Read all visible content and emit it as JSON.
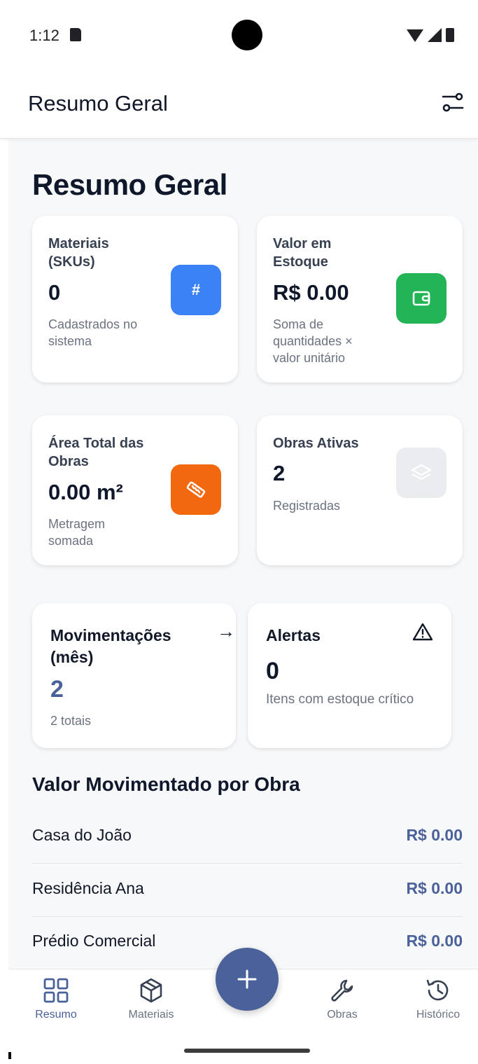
{
  "status_bar": {
    "time": "1:12"
  },
  "app_bar": {
    "title": "Resumo Geral"
  },
  "page": {
    "title": "Resumo Geral"
  },
  "cards": {
    "materiais": {
      "label_line1": "Materiais",
      "label_line2": "(SKUs)",
      "value": "0",
      "sub_line1": "Cadastrados no",
      "sub_line2": "sistema",
      "icon": "hash-icon",
      "icon_glyph": "#",
      "color": "#3b82f6"
    },
    "valor": {
      "label_line1": "Valor em",
      "label_line2": "Estoque",
      "value": "R$ 0.00",
      "sub_line1": "Soma de",
      "sub_line2": "quantidades ×",
      "sub_line3": "valor unitário",
      "icon": "wallet-icon",
      "color": "#22b455"
    },
    "area": {
      "label_line1": "Área Total das",
      "label_line2": "Obras",
      "value": "0.00 m²",
      "sub_line1": "Metragem",
      "sub_line2": "somada",
      "icon": "ruler-icon",
      "color": "#f2680f"
    },
    "obras": {
      "label": "Obras Ativas",
      "value": "2",
      "sub": "Registradas",
      "icon": "layers-icon",
      "color": "#ebecef"
    },
    "movimentacoes": {
      "label_line1": "Movimentações",
      "label_line2": "(mês)",
      "value": "2",
      "sub": "2 totais",
      "arrow": "→",
      "color": "#4a6199"
    },
    "alertas": {
      "label": "Alertas",
      "value": "0",
      "sub": "Itens com estoque crítico",
      "icon": "warning-icon"
    }
  },
  "section": {
    "title": "Valor Movimentado por Obra",
    "rows": [
      {
        "name": "Casa do João",
        "amount": "R$ 0.00"
      },
      {
        "name": "Residência Ana",
        "amount": "R$ 0.00"
      },
      {
        "name": "Prédio Comercial",
        "amount": "R$ 0.00"
      }
    ]
  },
  "nav": {
    "items": [
      {
        "label": "Resumo",
        "icon": "grid-icon",
        "active": true
      },
      {
        "label": "Materiais",
        "icon": "box-icon",
        "active": false
      },
      {
        "label": "Obras",
        "icon": "wrench-icon",
        "active": false
      },
      {
        "label": "Histórico",
        "icon": "history-icon",
        "active": false
      }
    ],
    "fab": {
      "glyph": "+",
      "icon": "plus-icon"
    }
  },
  "colors": {
    "accent": "#4a6199",
    "background": "#f7f8fa"
  }
}
